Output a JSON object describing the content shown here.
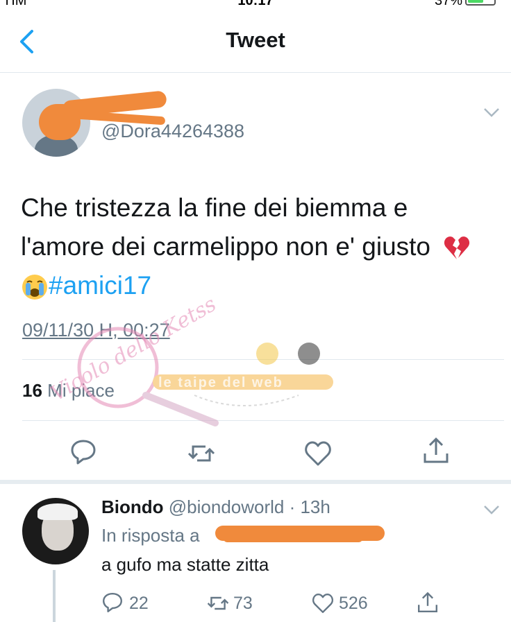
{
  "status_bar": {
    "carrier": "TIM",
    "time": "10:17",
    "battery": "37%"
  },
  "nav": {
    "title": "Tweet"
  },
  "tweet": {
    "handle": "@Dora44264388",
    "text_line1": "Che tristezza la fine dei biemma e",
    "text_line2": "l'amore dei carmelippo non e' giusto",
    "emoji_heart": "💔",
    "emoji_cry": "😭",
    "hashtag": "#amici17",
    "timestamp": "09/11/30 H, 00:27",
    "likes_count": "16",
    "likes_label": "Mi piace"
  },
  "reply": {
    "name": "Biondo",
    "meta": "@biondoworld · 13h",
    "in_reply_prefix": "In risposta a",
    "text": "a gufo ma statte zitta",
    "replies": "22",
    "retweets": "73",
    "likes": "526"
  },
  "watermark": {
    "script_text": "Vicolo dello Ketss",
    "banner": "le taipe del web"
  },
  "colors": {
    "accent": "#1da1f2",
    "muted": "#657786",
    "text": "#14171a",
    "divider": "#e1e8ed",
    "redaction": "#f08a3c"
  },
  "icons": [
    "back-chevron-icon",
    "dropdown-chevron-icon",
    "reply-icon",
    "retweet-icon",
    "like-icon",
    "share-icon",
    "broken-heart-icon",
    "crying-face-icon"
  ]
}
